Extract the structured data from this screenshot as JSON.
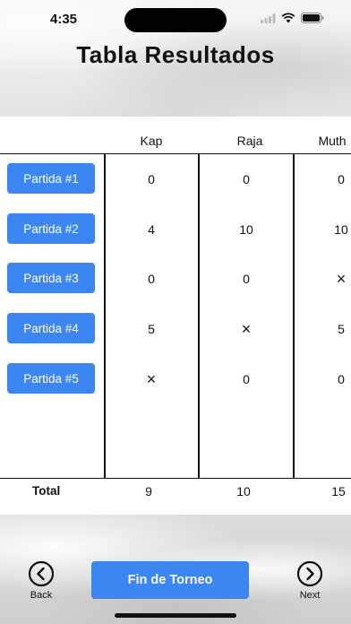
{
  "status_bar": {
    "time": "4:35"
  },
  "title": "Tabla Resultados",
  "players": [
    "Kap",
    "Raja",
    "Muth"
  ],
  "rounds": [
    {
      "label": "Partida #1",
      "scores": [
        "0",
        "0",
        "0"
      ]
    },
    {
      "label": "Partida #2",
      "scores": [
        "4",
        "10",
        "10"
      ]
    },
    {
      "label": "Partida #3",
      "scores": [
        "0",
        "0",
        "×"
      ]
    },
    {
      "label": "Partida #4",
      "scores": [
        "5",
        "×",
        "5"
      ]
    },
    {
      "label": "Partida #5",
      "scores": [
        "×",
        "0",
        "0"
      ]
    }
  ],
  "total": {
    "label": "Total",
    "values": [
      "9",
      "10",
      "15"
    ]
  },
  "footer": {
    "back_label": "Back",
    "next_label": "Next",
    "finish_label": "Fin de Torneo"
  },
  "colors": {
    "accent": "#3b86f0"
  }
}
